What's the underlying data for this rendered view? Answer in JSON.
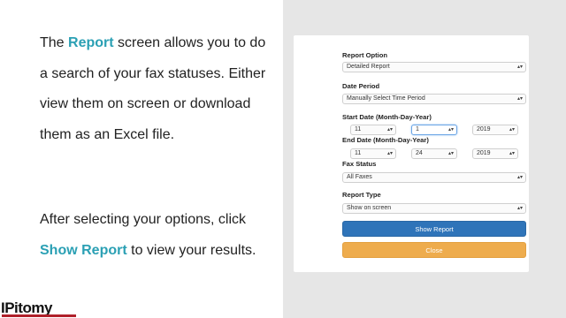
{
  "description": {
    "p1_pre": "The ",
    "p1_hl": "Report",
    "p1_post": " screen allows you to do a search of your fax statuses. Either view them on screen or download them as an Excel file.",
    "p2_pre": "After selecting your options, click ",
    "p2_hl": "Show Report",
    "p2_post": " to view your results."
  },
  "logo": {
    "text": "IPitomy"
  },
  "form": {
    "report_option_label": "Report Option",
    "report_option_value": "Detailed Report",
    "date_period_label": "Date Period",
    "date_period_value": "Manually Select Time Period",
    "start_date_label": "Start Date (Month-Day-Year)",
    "start_month": "11",
    "start_day": "1",
    "start_year": "2019",
    "end_date_label": "End Date (Month-Day-Year)",
    "end_month": "11",
    "end_day": "24",
    "end_year": "2019",
    "fax_status_label": "Fax Status",
    "fax_status_value": "All Faxes",
    "report_type_label": "Report Type",
    "report_type_value": "Show on screen",
    "show_report_label": "Show Report",
    "close_label": "Close",
    "arrow_glyph": "▴▾"
  },
  "colors": {
    "highlight": "#2ba0b4",
    "primary_button": "#2f74b9",
    "close_button": "#eeac4d",
    "panel_gray": "#e6e6e6",
    "logo_bar": "#b0202a"
  }
}
